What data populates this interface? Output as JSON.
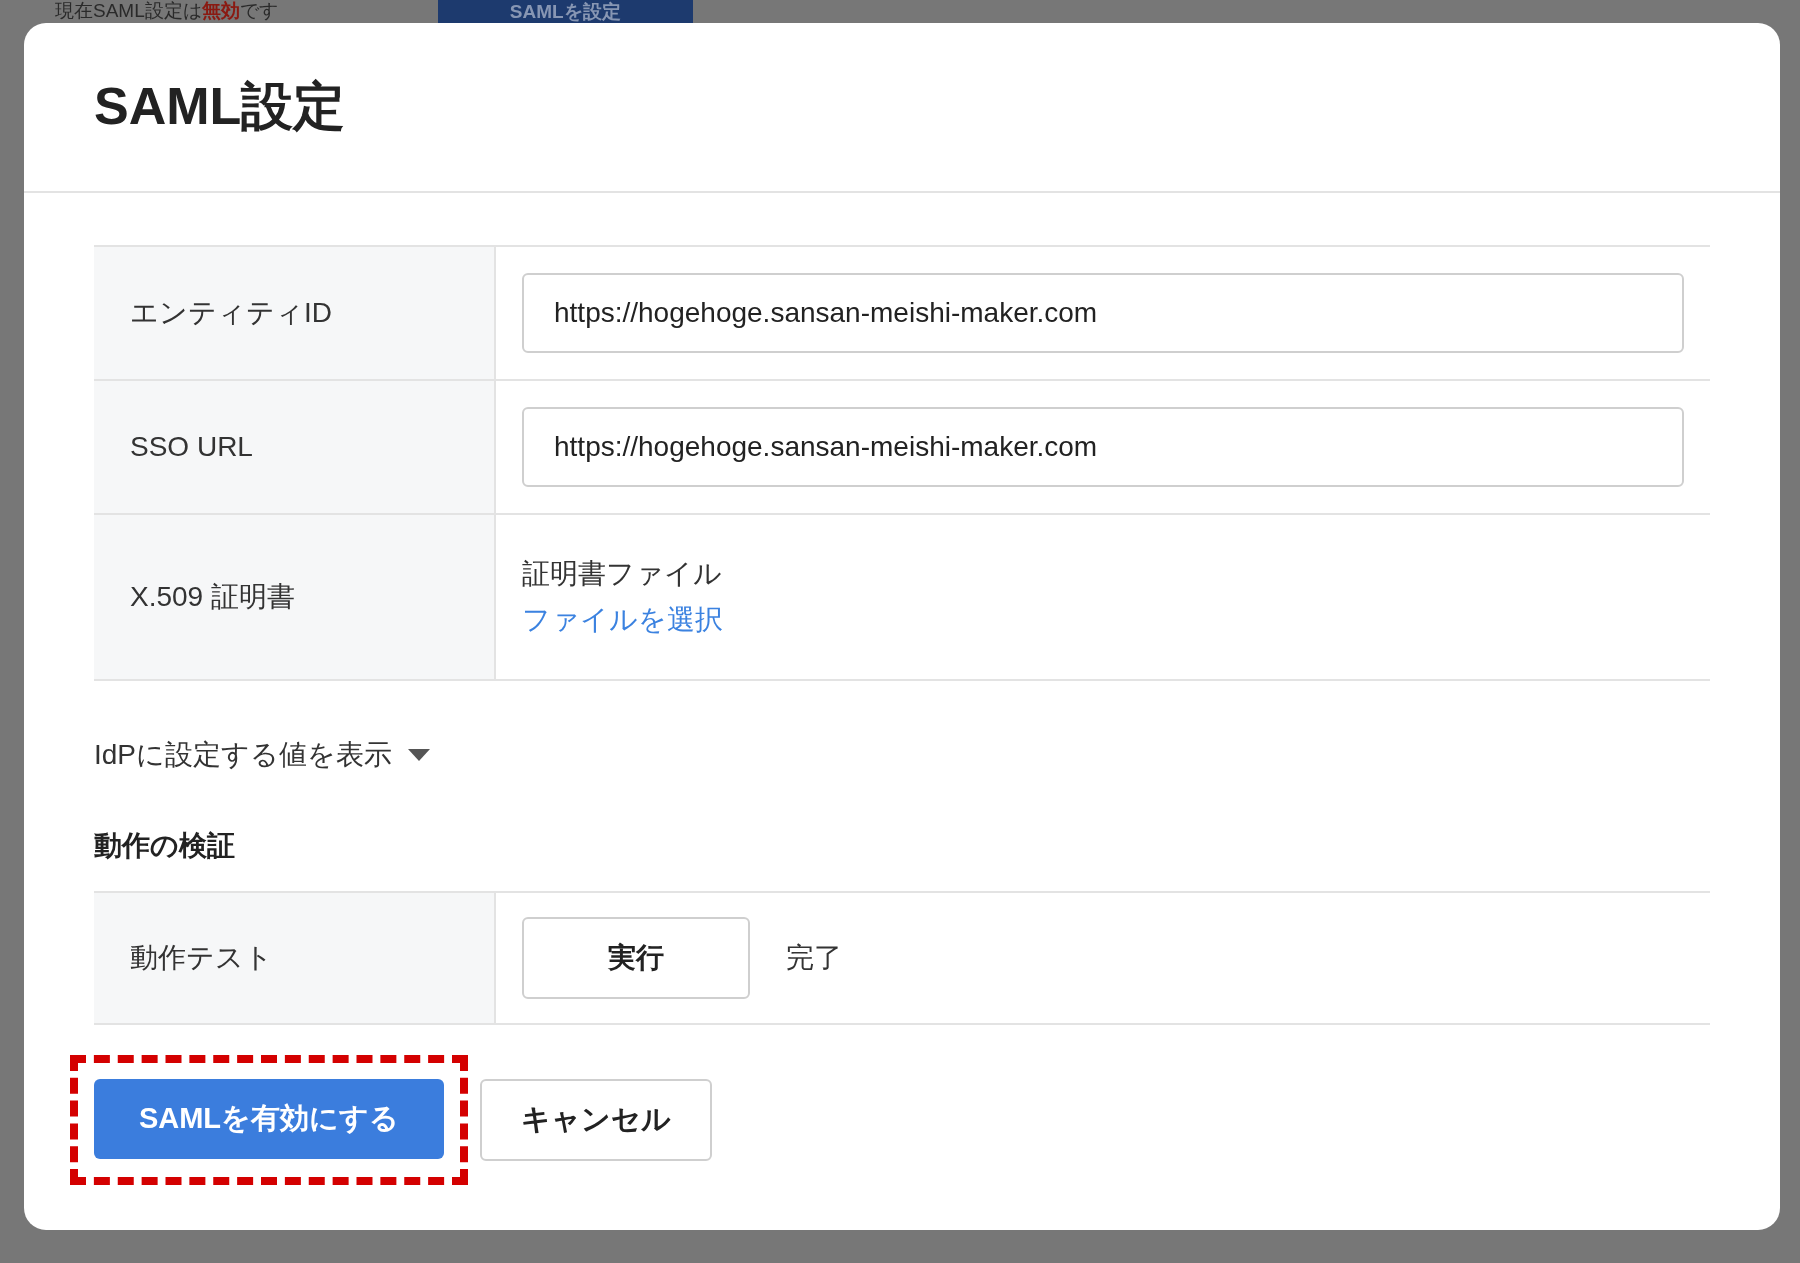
{
  "background_page": {
    "status_text": "現在SAML設定は**無効**です",
    "setup_button": "SAMLを設定"
  },
  "dialog": {
    "title": "SAML設定",
    "fields": [
      {
        "kind": "input",
        "label": "エンティティID",
        "value": "https://hogehoge.sansan-meishi-maker.com"
      },
      {
        "kind": "input",
        "label": "SSO URL",
        "value": "https://hogehoge.sansan-meishi-maker.com"
      },
      {
        "kind": "file",
        "label": "X.509 証明書",
        "caption": "証明書ファイル",
        "link": "ファイルを選択"
      }
    ],
    "idp_toggle": {
      "label": "IdPに設定する値を表示",
      "expanded": false
    },
    "verification": {
      "heading": "動作の検証",
      "label": "動作テスト",
      "run_button": "実行",
      "result": "完了"
    },
    "buttons": [
      {
        "kind": "primary",
        "label": "SAMLを有効にする",
        "highlighted": true
      },
      {
        "kind": "secondary",
        "label": "キャンセル",
        "highlighted": false
      }
    ]
  }
}
